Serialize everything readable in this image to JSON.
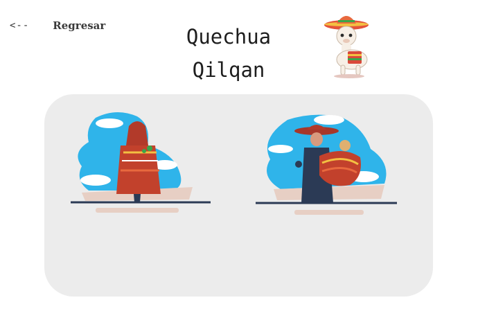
{
  "nav": {
    "back_arrow": "<--",
    "back_label": "Regresar"
  },
  "title": {
    "line1": "Quechua",
    "line2": "Qilqan"
  },
  "icons": {
    "mascot": "llama-sombrero-mascot",
    "art1": "poncho-figure-illustration",
    "art2": "mother-carrying-child-illustration"
  },
  "colors": {
    "panel": "#ececec",
    "sky": "#2fb4ea",
    "poncho_red": "#c2412c",
    "ground": "#2b3a55"
  }
}
